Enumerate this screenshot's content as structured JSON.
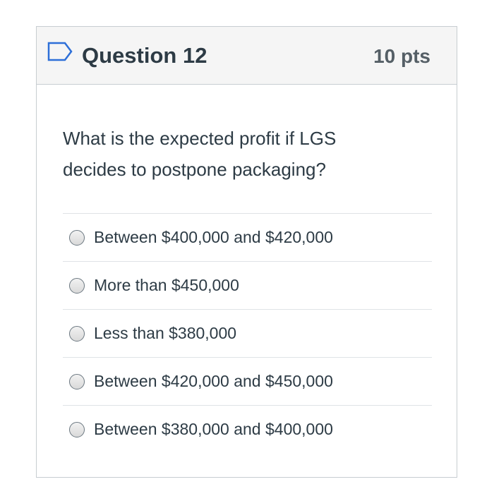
{
  "question": {
    "title": "Question 12",
    "points": "10 pts",
    "text": "What is the expected profit if LGS decides to postpone packaging?",
    "flag_icon": "flag-outline-icon",
    "answers": [
      {
        "label": "Between $400,000 and $420,000",
        "selected": false
      },
      {
        "label": "More than $450,000",
        "selected": false
      },
      {
        "label": "Less than $380,000",
        "selected": false
      },
      {
        "label": "Between $420,000 and $450,000",
        "selected": false
      },
      {
        "label": "Between $380,000 and $400,000",
        "selected": false
      }
    ]
  },
  "colors": {
    "text": "#2d3b45",
    "flag": "#2d6fd8",
    "header_bg": "#f5f5f5",
    "border": "#c7cdd1"
  }
}
